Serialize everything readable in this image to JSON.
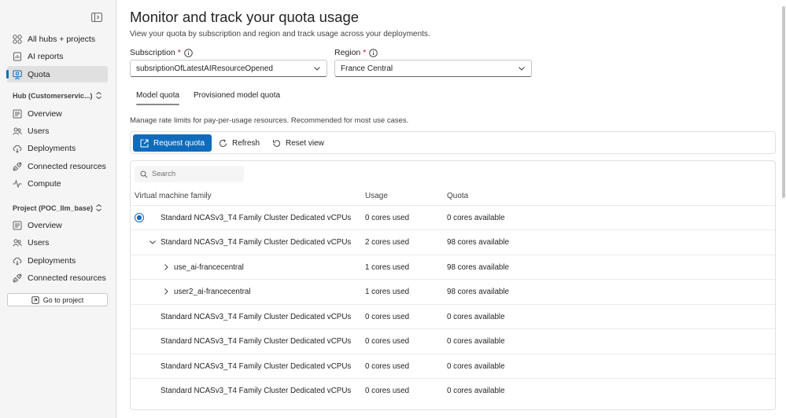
{
  "sidebar": {
    "top_items": [
      {
        "label": "All hubs + projects",
        "icon": "hubs-icon"
      },
      {
        "label": "AI reports",
        "icon": "report-icon"
      },
      {
        "label": "Quota",
        "icon": "quota-icon",
        "active": true
      }
    ],
    "hub_section": {
      "title": "Hub (Customerservic...)",
      "items": [
        {
          "label": "Overview",
          "icon": "overview-icon"
        },
        {
          "label": "Users",
          "icon": "users-icon"
        },
        {
          "label": "Deployments",
          "icon": "deployments-icon"
        },
        {
          "label": "Connected resources",
          "icon": "connected-resources-icon"
        },
        {
          "label": "Compute",
          "icon": "compute-icon"
        }
      ]
    },
    "project_section": {
      "title": "Project (POC_llm_base)",
      "items": [
        {
          "label": "Overview",
          "icon": "overview-icon"
        },
        {
          "label": "Users",
          "icon": "users-icon"
        },
        {
          "label": "Deployments",
          "icon": "deployments-icon"
        },
        {
          "label": "Connected resources",
          "icon": "connected-resources-icon"
        }
      ]
    },
    "go_to_project": "Go to project"
  },
  "header": {
    "title": "Monitor and track your quota usage",
    "subtitle": "View your quota by subscription and region and track usage across your deployments."
  },
  "filters": {
    "subscription": {
      "label": "Subscription",
      "required_mark": "*",
      "value": "subsriptionOfLatestAIResourceOpened"
    },
    "region": {
      "label": "Region",
      "required_mark": "*",
      "value": "France Central"
    }
  },
  "tabs": [
    {
      "label": "Model quota",
      "active": true
    },
    {
      "label": "Provisioned model quota",
      "active": false
    }
  ],
  "description": "Manage rate limits for pay-per-usage resources. Recommended for most use cases.",
  "toolbar": {
    "request_quota": "Request quota",
    "refresh": "Refresh",
    "reset_view": "Reset view"
  },
  "grid": {
    "search_placeholder": "Search",
    "columns": [
      "Virtual machine family",
      "Usage",
      "Quota"
    ],
    "rows": [
      {
        "name": "Standard NCASv3_T4 Family Cluster Dedicated vCPUs",
        "usage": "0 cores used",
        "quota": "0 cores available",
        "selected": true,
        "level": 0,
        "expander": "none"
      },
      {
        "name": "Standard NCASv3_T4 Family Cluster Dedicated vCPUs",
        "usage": "2 cores used",
        "quota": "98 cores available",
        "level": 0,
        "expander": "expanded"
      },
      {
        "name": "use_ai-francecentral",
        "usage": "1 cores used",
        "quota": "98 cores available",
        "level": 1,
        "expander": "collapsed"
      },
      {
        "name": "user2_ai-francecentral",
        "usage": "1 cores used",
        "quota": "98 cores available",
        "level": 1,
        "expander": "collapsed"
      },
      {
        "name": "Standard NCASv3_T4 Family Cluster Dedicated vCPUs",
        "usage": "0 cores used",
        "quota": "0 cores available",
        "level": 0,
        "expander": "none"
      },
      {
        "name": "Standard NCASv3_T4 Family Cluster Dedicated vCPUs",
        "usage": "0 cores used",
        "quota": "0 cores available",
        "level": 0,
        "expander": "none"
      },
      {
        "name": "Standard NCASv3_T4 Family Cluster Dedicated vCPUs",
        "usage": "0 cores used",
        "quota": "0 cores available",
        "level": 0,
        "expander": "none"
      },
      {
        "name": "Standard NCASv3_T4 Family Cluster Dedicated vCPUs",
        "usage": "0 cores used",
        "quota": "0 cores available",
        "level": 0,
        "expander": "none"
      }
    ]
  },
  "colors": {
    "accent": "#0f6cbd",
    "required": "#c50f1f"
  }
}
